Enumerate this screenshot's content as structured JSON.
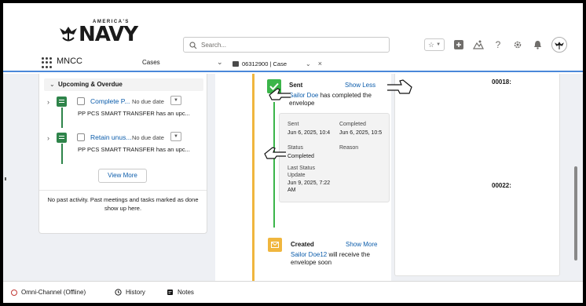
{
  "header": {
    "logo_top": "AMERICA'S",
    "logo_main": "NAVY",
    "search_placeholder": "Search..."
  },
  "nav": {
    "app_name": "MNCC",
    "tab": "Cases",
    "subtab": "06312900 | Case"
  },
  "left": {
    "section_title": "Upcoming & Overdue",
    "tasks": [
      {
        "title": "Complete P...",
        "due": "No due date",
        "subject": "PP PCS SMART TRANSFER has an upc..."
      },
      {
        "title": "Retain unus...",
        "due": "No due date",
        "subject": "PP PCS SMART TRANSFER has an upc..."
      }
    ],
    "view_more": "View More",
    "no_past": "No past activity. Past meetings and tasks marked as done show up here."
  },
  "timeline": {
    "sent": {
      "title": "Sent",
      "action": "Show Less",
      "actor": "Sailor Doe",
      "desc": " has completed the envelope",
      "sent_label": "Sent",
      "sent_value": "Jun 6, 2025, 10:4",
      "completed_label": "Completed",
      "completed_value": "Jun 6, 2025, 10:5",
      "status_label": "Status",
      "status_value": "Completed",
      "reason_label": "Reason",
      "last_label": "Last Status Update",
      "last_value": "Jun 9, 2025, 7:22 AM"
    },
    "created": {
      "title": "Created",
      "action": "Show More",
      "actor": "Sailor Doe12",
      "desc": " will receive the envelope soon"
    }
  },
  "right": {
    "num1": "00018:",
    "num2": "00022:"
  },
  "utility": {
    "omni": "Omni-Channel (Offline)",
    "history": "History",
    "notes": "Notes"
  }
}
